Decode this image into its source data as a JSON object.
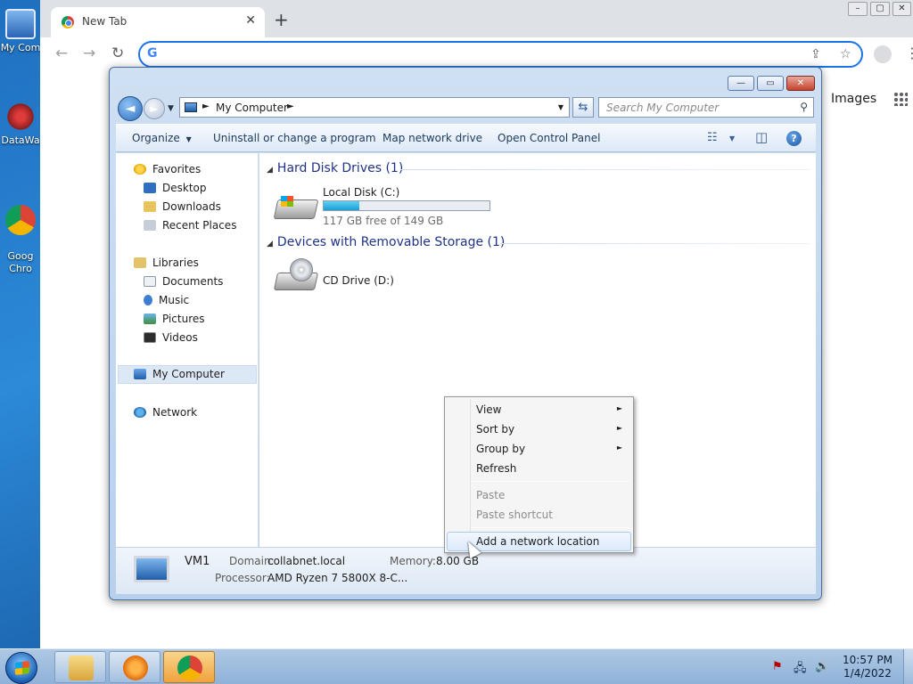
{
  "desktop": {
    "icons": [
      {
        "label": "My Com",
        "icon": "computer-icon"
      },
      {
        "label": "DataWa",
        "icon": "datawarehouse-icon"
      },
      {
        "label": "Goog\nChro",
        "icon": "chrome-icon"
      }
    ]
  },
  "browser": {
    "tab_title": "New Tab",
    "tab_close": "✕",
    "new_tab": "+",
    "window_controls": [
      "–",
      "▢",
      "✕"
    ],
    "back": "←",
    "forward": "→",
    "reload": "↻",
    "omnibox_logo": "G",
    "omnibox_value": "",
    "share_glyph": "⇪",
    "star_glyph": "☆",
    "kebab": "⋮",
    "images_link": "Images"
  },
  "explorer": {
    "caption_buttons": [
      "—",
      "▭",
      "✕"
    ],
    "back_glyph": "◄",
    "forward_glyph": "►",
    "nav_dropdown": "▼",
    "address": {
      "separator": "►",
      "location": "My Computer",
      "dropdown": "▼"
    },
    "refresh_glyph": "⇆",
    "search_placeholder": "Search My Computer",
    "search_glyph": "⚲",
    "commands": {
      "organize": "Organize",
      "organize_arrow": "▼",
      "uninstall": "Uninstall or change a program",
      "map_drive": "Map network drive",
      "control_panel": "Open Control Panel",
      "view_glyph": "☷",
      "view_arrow": "▼",
      "preview_glyph": "◫",
      "help_glyph": "?"
    },
    "nav": {
      "favorites": "Favorites",
      "desktop": "Desktop",
      "downloads": "Downloads",
      "recent": "Recent Places",
      "libraries": "Libraries",
      "documents": "Documents",
      "music": "Music",
      "pictures": "Pictures",
      "videos": "Videos",
      "computer": "My Computer",
      "network": "Network"
    },
    "groups": {
      "collapse_glyph": "◢",
      "hdd": "Hard Disk Drives (1)",
      "removable": "Devices with Removable Storage (1)"
    },
    "drives": {
      "c_name": "Local Disk (C:)",
      "c_space": "117 GB free of 149 GB",
      "c_used_fraction": 0.215,
      "d_name": "CD Drive (D:)"
    },
    "details": {
      "name": "VM1",
      "domain_label": "Domain:",
      "domain": "collabnet.local",
      "memory_label": "Memory:",
      "memory": "8.00 GB",
      "processor_label": "Processor:",
      "processor": "AMD Ryzen 7 5800X 8-C..."
    }
  },
  "context_menu": {
    "arrow": "►",
    "view": "View",
    "sort_by": "Sort by",
    "group_by": "Group by",
    "refresh": "Refresh",
    "paste": "Paste",
    "paste_shortcut": "Paste shortcut",
    "add_network_location": "Add a network location"
  },
  "taskbar": {
    "tray": {
      "network_glyph": "🖧",
      "flag_glyph": "⚑",
      "volume_glyph": "🔊"
    },
    "time": "10:57 PM",
    "date": "1/4/2022"
  }
}
